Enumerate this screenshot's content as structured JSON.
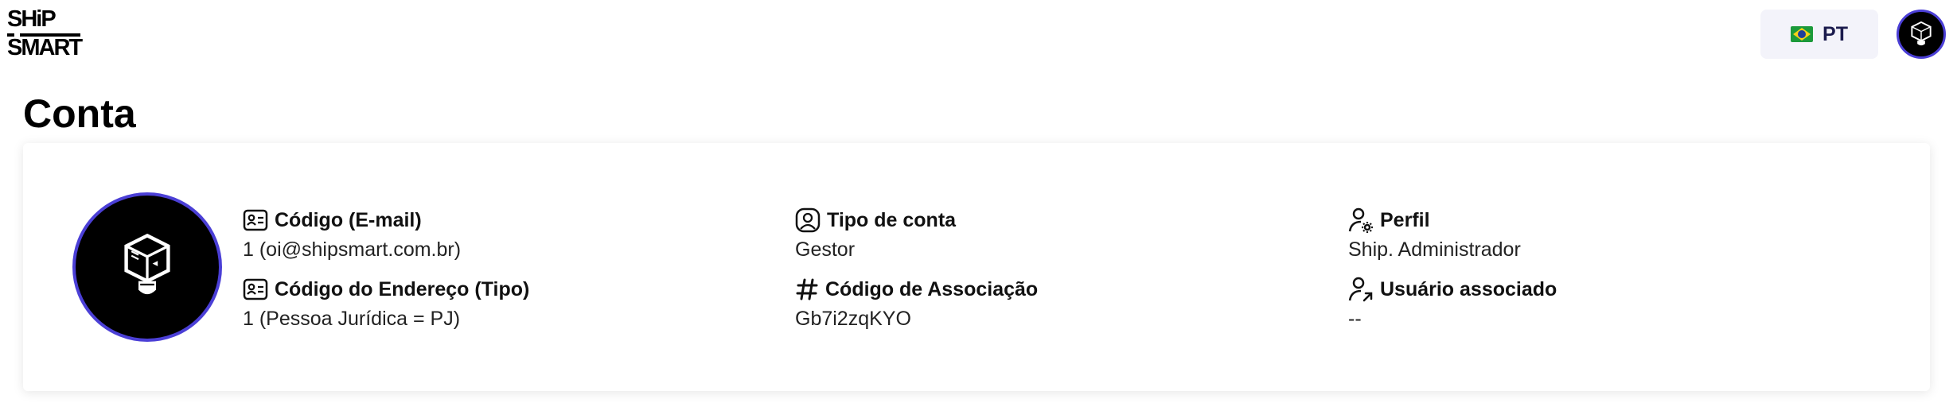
{
  "header": {
    "logo": {
      "line1": "SHiP",
      "line2": "SMART"
    },
    "language": {
      "label": "PT",
      "flag": "brazil-flag-icon"
    },
    "user_avatar": "lightbulb-cube-icon"
  },
  "page": {
    "title": "Conta"
  },
  "account": {
    "avatar": "lightbulb-cube-icon",
    "fields": [
      {
        "label": "Código (E-mail)",
        "value": "1 (oi@shipsmart.com.br)",
        "icon": "id-card-icon"
      },
      {
        "label": "Código do Endereço (Tipo)",
        "value": "1 (Pessoa Jurídica = PJ)",
        "icon": "id-card-icon"
      },
      {
        "label": "Tipo de conta",
        "value": "Gestor",
        "icon": "user-square-icon"
      },
      {
        "label": "Código de Associação",
        "value": "Gb7i2zqKYO",
        "icon": "hash-icon"
      },
      {
        "label": "Perfil",
        "value": "Ship. Administrador",
        "icon": "user-gear-icon"
      },
      {
        "label": "Usuário associado",
        "value": "--",
        "icon": "user-link-icon"
      }
    ]
  },
  "colors": {
    "accent": "#4b3fd6",
    "lang_bg": "#f3f3fa",
    "text": "#111111"
  }
}
